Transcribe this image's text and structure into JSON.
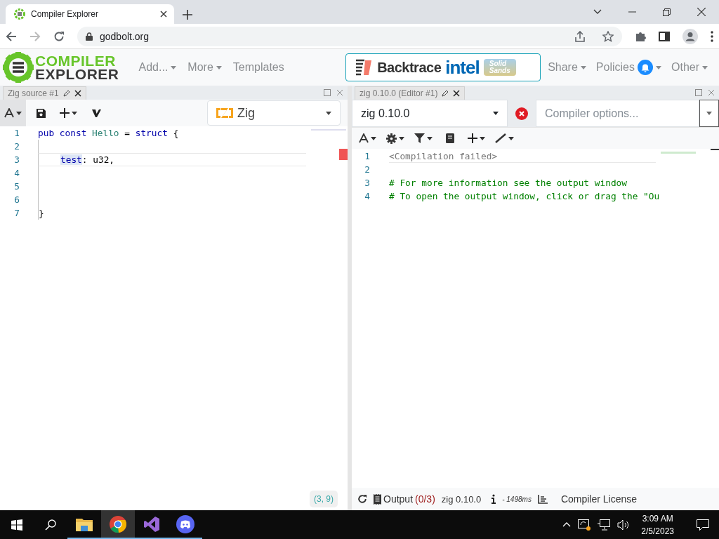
{
  "browser": {
    "tab_title": "Compiler Explorer",
    "url": "godbolt.org"
  },
  "navbar": {
    "logo": [
      "COMPILER",
      "EXPLORER"
    ],
    "left_menus": [
      {
        "label": "Add...",
        "dropdown": true
      },
      {
        "label": "More",
        "dropdown": true
      },
      {
        "label": "Templates",
        "dropdown": false
      }
    ],
    "sponsors": [
      "Backtrace",
      "intel",
      "Solid",
      "Sands"
    ],
    "right_menus": [
      {
        "label": "Share",
        "badge": false
      },
      {
        "label": "Policies",
        "badge": true
      },
      {
        "label": "Other",
        "badge": false
      }
    ]
  },
  "source_pane": {
    "tab": "Zig source #1",
    "language": "Zig",
    "lines": [
      {
        "number": "1",
        "current": false,
        "indent": false,
        "tokens": [
          {
            "kind": "keyword",
            "text": "pub const "
          },
          {
            "kind": "type",
            "text": "Hello"
          },
          {
            "kind": "plain",
            "text": " = "
          },
          {
            "kind": "keyword",
            "text": "struct"
          },
          {
            "kind": "plain",
            "text": " {"
          }
        ]
      },
      {
        "number": "2",
        "current": false
      },
      {
        "number": "3",
        "current": true,
        "indent": true,
        "tokens": [
          {
            "kind": "selected",
            "text": "test"
          },
          {
            "kind": "plain",
            "text": ": u32,"
          }
        ]
      },
      {
        "number": "4",
        "current": false
      },
      {
        "number": "5",
        "current": false
      },
      {
        "number": "6",
        "current": false
      },
      {
        "number": "7",
        "current": false,
        "indent": false,
        "tokens": [
          {
            "kind": "plain",
            "text": "}"
          }
        ]
      }
    ],
    "cursor_position": "(3, 9)"
  },
  "compiler_pane": {
    "tab": "zig 0.10.0 (Editor #1)",
    "compiler": "zig 0.10.0",
    "options_placeholder": "Compiler options...",
    "lines": [
      {
        "number": "1",
        "kind": "placeholder",
        "text": "<Compilation failed>"
      },
      {
        "number": "2",
        "kind": "comment"
      },
      {
        "number": "3",
        "kind": "comment",
        "text": "# For more information see the output window"
      },
      {
        "number": "4",
        "kind": "comment",
        "text": "# To open the output window, click or drag the \"Ou"
      }
    ],
    "status_bar": {
      "output_label": "Output",
      "output_count": "(0/3)",
      "compiler": "zig 0.10.0",
      "time": "- 1498ms",
      "license": "Compiler License"
    }
  },
  "taskbar": {
    "apps": [
      {
        "kind": "folder",
        "active": false
      },
      {
        "kind": "chrome",
        "active": true
      },
      {
        "kind": "studio",
        "active": false
      },
      {
        "kind": "discord",
        "active": false
      }
    ],
    "time": "3:09 AM",
    "date": "2/5/2023"
  }
}
